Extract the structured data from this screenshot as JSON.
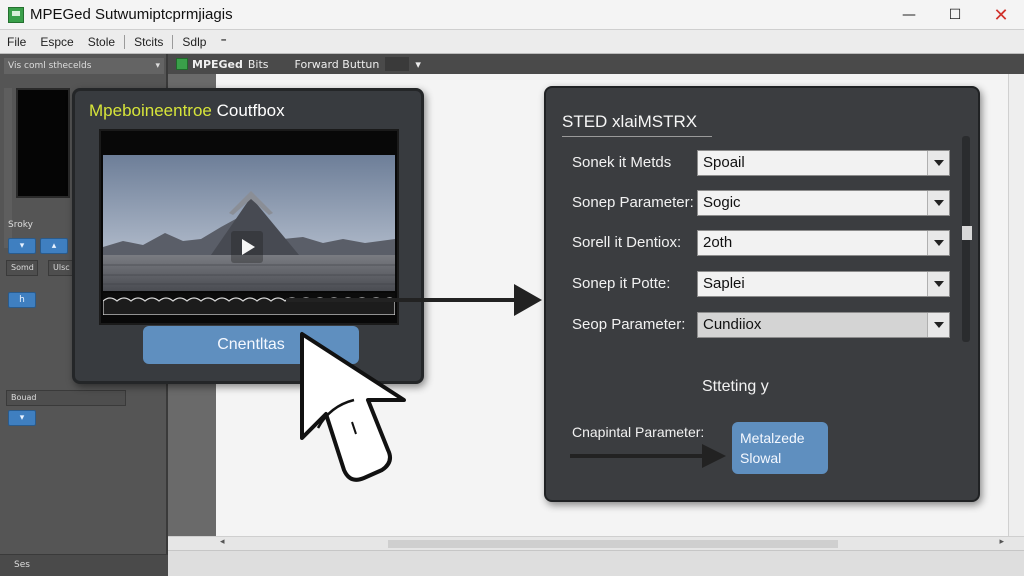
{
  "window": {
    "title": "MPEGed Sutwumiptcprmjiagis",
    "min_glyph": "—",
    "max_glyph": "☐",
    "close_glyph": "✕"
  },
  "menu": {
    "items": [
      "File",
      "Espce",
      "Stole",
      "Stcits",
      "Sdlp"
    ],
    "more_glyph": "⁼"
  },
  "sidebar": {
    "header": "Vis coml sthecelds",
    "header_arrow": "▾",
    "label_a": "Sroky",
    "btn_a": "▾",
    "btn_b": "▴",
    "label_b": "Somd",
    "label_c": "Ulsc",
    "btn_c": "h",
    "box_a": "Bouad",
    "btn_d": "▾",
    "footer": "Ses"
  },
  "toolbar": {
    "app_label": "MPEGed",
    "bits": "Bits",
    "forward": "Forward Buttun",
    "arrow": "▾"
  },
  "scrollbar": {
    "left": "◂",
    "right": "▸"
  },
  "card": {
    "title_accent": "Mpeboineentroe",
    "title_rest": " Coutfbox",
    "button": "Cnentltas"
  },
  "panel": {
    "title": "STED xlaiMSTRX",
    "rows": [
      {
        "label": "Sonek it Metds",
        "value": "Spoail"
      },
      {
        "label": "Sonep Parameter:",
        "value": "Sogic"
      },
      {
        "label": "Sorell it Dentiox:",
        "value": "2oth"
      },
      {
        "label": "Sonep it Potte:",
        "value": "Saplei"
      },
      {
        "label": "Seop Parameter:",
        "value": "Cundiiox"
      }
    ],
    "setting": "Stteting y",
    "capital_label": "Cnapintal Parameter:",
    "apply_line1": "Metalzede",
    "apply_line2": "Slowal"
  },
  "colors": {
    "accent_blue": "#5f8fbf",
    "title_yellow": "#d6e43a",
    "panel_bg": "#3b3d40",
    "close_red": "#d0302a"
  }
}
